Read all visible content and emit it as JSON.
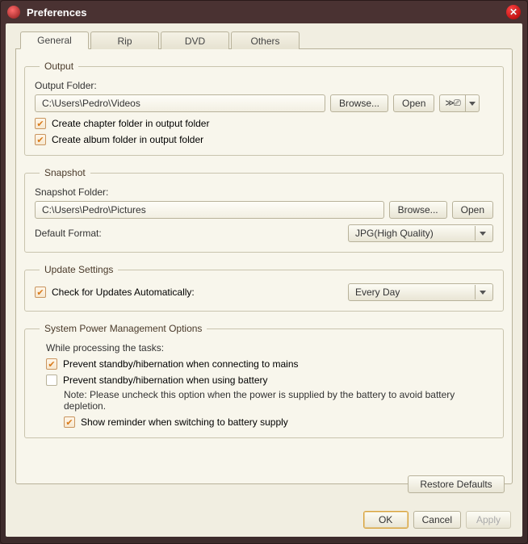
{
  "window": {
    "title": "Preferences"
  },
  "tabs": {
    "general": "General",
    "rip": "Rip",
    "dvd": "DVD",
    "others": "Others"
  },
  "output": {
    "legend": "Output",
    "folder_label": "Output Folder:",
    "folder_value": "C:\\Users\\Pedro\\Videos",
    "browse": "Browse...",
    "open": "Open",
    "chk_chapter": "Create chapter folder in output folder",
    "chk_album": "Create album folder in output folder"
  },
  "snapshot": {
    "legend": "Snapshot",
    "folder_label": "Snapshot Folder:",
    "folder_value": "C:\\Users\\Pedro\\Pictures",
    "browse": "Browse...",
    "open": "Open",
    "format_label": "Default Format:",
    "format_value": "JPG(High Quality)"
  },
  "update": {
    "legend": "Update Settings",
    "chk_auto": "Check for Updates Automatically:",
    "freq_value": "Every Day"
  },
  "power": {
    "legend": "System Power Management Options",
    "while": "While processing the tasks:",
    "chk_mains": "Prevent standby/hibernation when connecting to mains",
    "chk_battery": "Prevent standby/hibernation when using battery",
    "note": "Note: Please uncheck this option when the power is supplied by the battery to avoid battery depletion.",
    "chk_reminder": "Show reminder when switching to battery supply"
  },
  "buttons": {
    "restore": "Restore Defaults",
    "ok": "OK",
    "cancel": "Cancel",
    "apply": "Apply"
  }
}
